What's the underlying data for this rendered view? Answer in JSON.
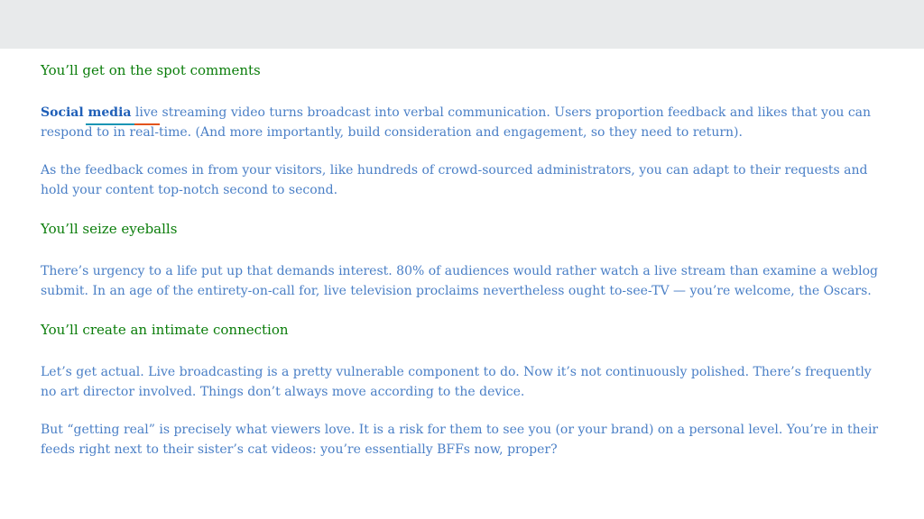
{
  "sections": [
    {
      "heading": "You’ll get on the spot comments",
      "paragraphs": [
        {
          "lead_bold": "Social media",
          "lead_link": "live",
          "text": " streaming video turns broadcast into verbal communication. Users proportion feedback and likes that you can respond to in real-time. (And more importantly, build consideration and engagement, so they need to return)."
        },
        {
          "text": "As the feedback comes in from your visitors, like hundreds of crowd-sourced administrators, you can adapt to their requests and hold your content top-notch second to second."
        }
      ]
    },
    {
      "heading": "You’ll seize eyeballs",
      "paragraphs": [
        {
          "text": "There’s urgency to a life put up that demands interest. 80% of audiences would rather watch a live stream than examine a weblog submit. In an age of the entirety-on-call for, live television proclaims nevertheless ought to-see-TV — you’re welcome, the Oscars."
        }
      ]
    },
    {
      "heading": "You’ll create an intimate connection",
      "paragraphs": [
        {
          "text": "Let’s get actual. Live broadcasting is a pretty vulnerable component to do. Now it’s not continuously polished. There’s frequently no art director involved. Things don’t always move according to the device."
        },
        {
          "text": "But “getting real” is precisely what viewers love. It is a risk for them to see you (or your brand) on a personal level. You’re in their feeds right next to their sister’s cat videos: you’re essentially BFFs now, proper?"
        }
      ]
    }
  ]
}
